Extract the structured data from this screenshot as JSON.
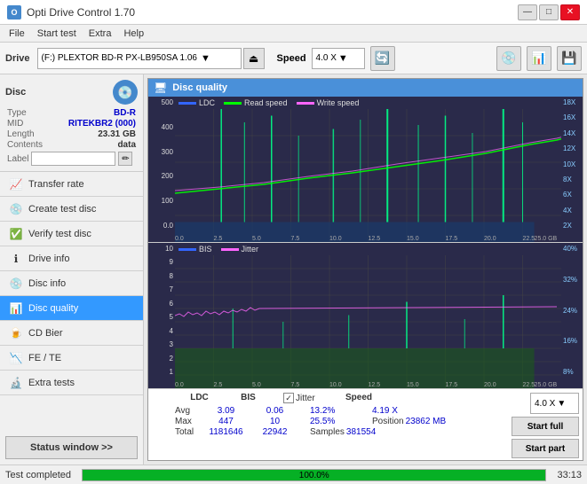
{
  "window": {
    "title": "Opti Drive Control 1.70",
    "icon": "O"
  },
  "titlebar": {
    "minimize": "—",
    "maximize": "□",
    "close": "✕"
  },
  "menu": {
    "items": [
      "File",
      "Start test",
      "Extra",
      "Help"
    ]
  },
  "toolbar": {
    "drive_label": "Drive",
    "drive_value": "(F:) PLEXTOR BD-R  PX-LB950SA 1.06",
    "speed_label": "Speed",
    "speed_value": "4.0 X"
  },
  "disc": {
    "title": "Disc",
    "type_label": "Type",
    "type_value": "BD-R",
    "mid_label": "MID",
    "mid_value": "RITEKBR2 (000)",
    "length_label": "Length",
    "length_value": "23.31 GB",
    "contents_label": "Contents",
    "contents_value": "data",
    "label_label": "Label"
  },
  "nav": {
    "items": [
      {
        "id": "transfer-rate",
        "label": "Transfer rate",
        "icon": "📈"
      },
      {
        "id": "create-test-disc",
        "label": "Create test disc",
        "icon": "💿"
      },
      {
        "id": "verify-test-disc",
        "label": "Verify test disc",
        "icon": "✅"
      },
      {
        "id": "drive-info",
        "label": "Drive info",
        "icon": "ℹ️"
      },
      {
        "id": "disc-info",
        "label": "Disc info",
        "icon": "💿"
      },
      {
        "id": "disc-quality",
        "label": "Disc quality",
        "icon": "📊",
        "active": true
      },
      {
        "id": "cd-bier",
        "label": "CD Bier",
        "icon": "🍺"
      },
      {
        "id": "fe-te",
        "label": "FE / TE",
        "icon": "📉"
      },
      {
        "id": "extra-tests",
        "label": "Extra tests",
        "icon": "🔬"
      }
    ]
  },
  "status_btn": "Status window >>",
  "chart": {
    "title": "Disc quality",
    "icon": "🖥",
    "legend_upper": {
      "ldc_label": "LDC",
      "ldc_color": "#3366ff",
      "read_label": "Read speed",
      "read_color": "#00ff00",
      "write_label": "Write speed",
      "write_color": "#ff66ff"
    },
    "legend_lower": {
      "bis_label": "BIS",
      "bis_color": "#3366ff",
      "jitter_label": "Jitter",
      "jitter_color": "#ff66ff"
    },
    "upper_y_left": [
      "500",
      "400",
      "300",
      "200",
      "100",
      "0.0"
    ],
    "upper_y_right": [
      "18X",
      "16X",
      "14X",
      "12X",
      "10X",
      "8X",
      "6X",
      "4X",
      "2X"
    ],
    "upper_x": [
      "0.0",
      "2.5",
      "5.0",
      "7.5",
      "10.0",
      "12.5",
      "15.0",
      "17.5",
      "20.0",
      "22.5",
      "25.0 GB"
    ],
    "lower_y_left": [
      "10",
      "9",
      "8",
      "7",
      "6",
      "5",
      "4",
      "3",
      "2",
      "1"
    ],
    "lower_y_right": [
      "40%",
      "32%",
      "24%",
      "16%",
      "8%"
    ],
    "lower_x": [
      "0.0",
      "2.5",
      "5.0",
      "7.5",
      "10.0",
      "12.5",
      "15.0",
      "17.5",
      "20.0",
      "22.5",
      "25.0 GB"
    ]
  },
  "stats": {
    "headers": [
      "LDC",
      "BIS",
      "",
      "Jitter",
      "Speed",
      ""
    ],
    "rows": [
      {
        "label": "Avg",
        "ldc": "3.09",
        "bis": "0.06",
        "jitter": "13.2%",
        "speed": "4.19 X"
      },
      {
        "label": "Max",
        "ldc": "447",
        "bis": "10",
        "jitter": "25.5%",
        "position": "23862 MB"
      },
      {
        "label": "Total",
        "ldc": "1181646",
        "bis": "22942",
        "samples": "381554"
      }
    ],
    "jitter_checked": true,
    "jitter_label": "Jitter",
    "speed_label": "Speed",
    "speed_value": "4.19 X",
    "speed_display": "4.0 X",
    "position_label": "Position",
    "position_value": "23862 MB",
    "samples_label": "Samples",
    "samples_value": "381554",
    "start_full_label": "Start full",
    "start_part_label": "Start part"
  },
  "bottom": {
    "status_text": "Test completed",
    "progress_percent": "100.0%",
    "progress_value": 100,
    "time": "33:13"
  }
}
